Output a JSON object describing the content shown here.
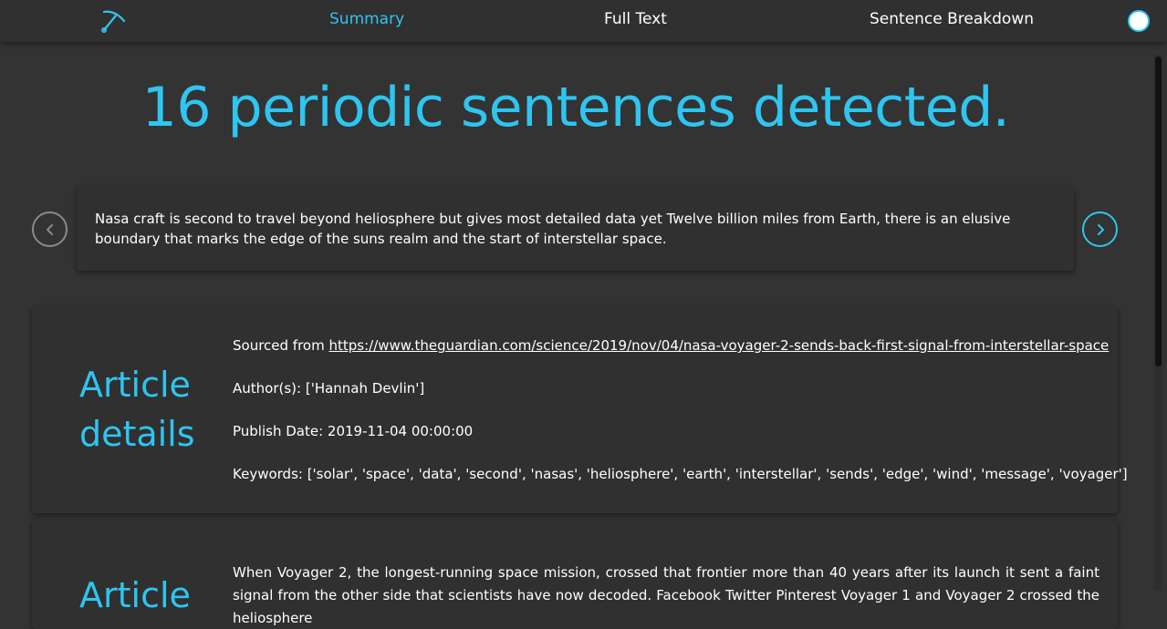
{
  "nav": {
    "logo_icon": "pickaxe-icon",
    "links": [
      "Summary",
      "Full Text",
      "Sentence Breakdown"
    ],
    "active": "Summary",
    "accent_color": "#2ec5f0"
  },
  "headline": "16 periodic sentences detected.",
  "carousel": {
    "prev_icon": "chevron-left-icon",
    "next_icon": "chevron-right-icon",
    "sentence": "Nasa craft is second to travel beyond heliosphere but gives most detailed data yet Twelve billion miles from Earth, there is an elusive boundary that marks the edge of the suns realm and the start of interstellar space."
  },
  "article_details": {
    "heading_line1": "Article",
    "heading_line2": "details",
    "source_label": "Sourced from ",
    "source_url": "https://www.theguardian.com/science/2019/nov/04/nasa-voyager-2-sends-back-first-signal-from-interstellar-space",
    "authors": "Author(s): ['Hannah Devlin']",
    "publish_date": "Publish Date: 2019-11-04 00:00:00",
    "keywords": "Keywords: ['solar', 'space', 'data', 'second', 'nasas', 'heliosphere', 'earth', 'interstellar', 'sends', 'edge', 'wind', 'message', 'voyager']"
  },
  "article_text": {
    "heading": "Article",
    "body": "When Voyager 2, the longest-running space mission, crossed that frontier more than 40 years after its launch it sent a faint signal from the other side that scientists have now decoded. Facebook Twitter Pinterest Voyager 1 and Voyager 2 crossed the heliosphere"
  }
}
